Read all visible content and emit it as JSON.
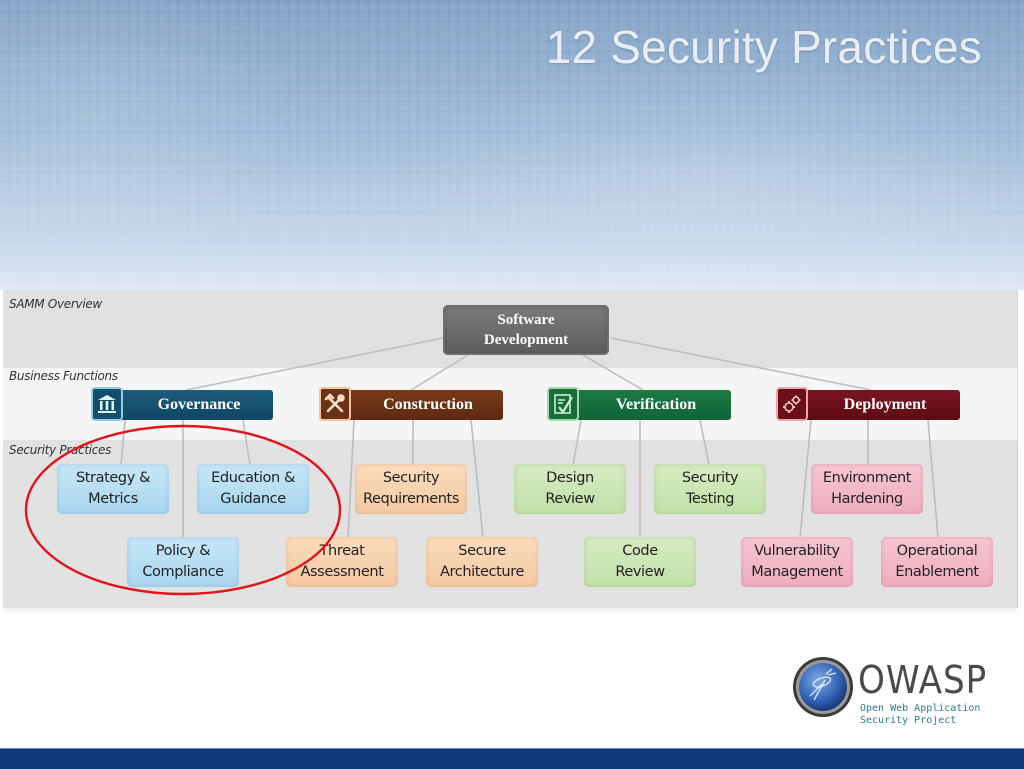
{
  "slide": {
    "title": "12 Security Practices"
  },
  "diagram": {
    "section_labels": {
      "overview": "SAMM Overview",
      "business_functions": "Business Functions",
      "security_practices": "Security Practices"
    },
    "root": {
      "line1": "Software",
      "line2": "Development",
      "color": "#6a6a6a"
    },
    "business_functions": [
      {
        "label": "Governance",
        "icon": "building-columns-icon",
        "color": "#17536f"
      },
      {
        "label": "Construction",
        "icon": "wrench-hammer-icon",
        "color": "#6d3215"
      },
      {
        "label": "Verification",
        "icon": "checklist-icon",
        "color": "#166e3e"
      },
      {
        "label": "Deployment",
        "icon": "gears-icon",
        "color": "#6d101b"
      }
    ],
    "security_practices": [
      {
        "function": "Governance",
        "line1": "Strategy &",
        "line2": "Metrics",
        "color": "#b9def2"
      },
      {
        "function": "Governance",
        "line1": "Education &",
        "line2": "Guidance",
        "color": "#b9def2"
      },
      {
        "function": "Governance",
        "line1": "Policy &",
        "line2": "Compliance",
        "color": "#b9def2"
      },
      {
        "function": "Construction",
        "line1": "Security",
        "line2": "Requirements",
        "color": "#f7d2b0"
      },
      {
        "function": "Construction",
        "line1": "Threat",
        "line2": "Assessment",
        "color": "#f7d2b0"
      },
      {
        "function": "Construction",
        "line1": "Secure",
        "line2": "Architecture",
        "color": "#f7d2b0"
      },
      {
        "function": "Verification",
        "line1": "Design",
        "line2": "Review",
        "color": "#cce6b5"
      },
      {
        "function": "Verification",
        "line1": "Security",
        "line2": "Testing",
        "color": "#cce6b5"
      },
      {
        "function": "Verification",
        "line1": "Code",
        "line2": "Review",
        "color": "#cce6b5"
      },
      {
        "function": "Deployment",
        "line1": "Environment",
        "line2": "Hardening",
        "color": "#f2bac9"
      },
      {
        "function": "Deployment",
        "line1": "Vulnerability",
        "line2": "Management",
        "color": "#f2bac9"
      },
      {
        "function": "Deployment",
        "line1": "Operational",
        "line2": "Enablement",
        "color": "#f2bac9"
      }
    ],
    "highlight": {
      "shape": "ellipse",
      "color": "#e3121b",
      "encloses": "Governance practices"
    }
  },
  "logo": {
    "name": "OWASP",
    "subtitle_line1": "Open Web Application",
    "subtitle_line2": "Security Project"
  },
  "theme": {
    "footer_color": "#0d3a78"
  }
}
